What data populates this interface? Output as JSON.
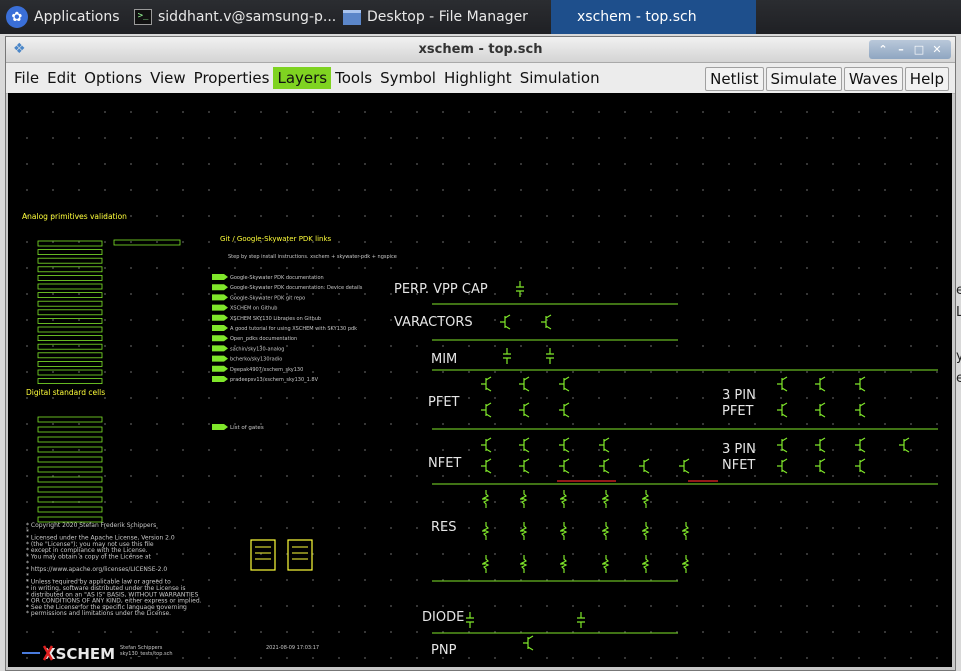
{
  "taskbar": {
    "applications": "Applications",
    "terminal": "siddhant.v@samsung-p...",
    "file_manager": "Desktop - File Manager",
    "xschem": "xschem - top.sch"
  },
  "window": {
    "title": "xschem - top.sch",
    "controls": [
      "⌃",
      "–",
      "□",
      "✕"
    ]
  },
  "menu": {
    "left": [
      "File",
      "Edit",
      "Options",
      "View",
      "Properties",
      "Layers",
      "Tools",
      "Symbol",
      "Highlight",
      "Simulation"
    ],
    "active": "Layers",
    "right": [
      "Netlist",
      "Simulate",
      "Waves",
      "Help"
    ]
  },
  "schematic": {
    "analog_title": "Analog primitives validation",
    "digital_title": "Digital standard cells",
    "links_title": "Git / Google-Skywater PDK links",
    "links_step": "Step by step install instructions. xschem + skywater-pdk + ngspice",
    "links": [
      "Google-Skywater PDK documentation",
      "Google-Skywater PDK documentation: Device details",
      "Google-Skywater PDK git repo",
      "XSCHEM on Github",
      "XSCHEM SKY130 Libraries on Github",
      "A good tutorial for using XSCHEM with SKY130 pdk",
      "Open_pdks documentation",
      "sachin/sky130-analog",
      "bcherko/sky130radio",
      "Deepak4907/xschem_sky130",
      "pradeepsv13/xschem_sky130_1.8V"
    ],
    "gates_link": "List of gates",
    "device_labels": [
      "PERP. VPP CAP",
      "VARACTORS",
      "MIM",
      "PFET",
      "NFET",
      "RES",
      "DIODE",
      "PNP"
    ],
    "three_pin_pfet": [
      "3 PIN",
      "PFET"
    ],
    "three_pin_nfet": [
      "3 PIN",
      "NFET"
    ],
    "license": [
      "* Copyright 2020 Stefan Frederik Schippers",
      "*",
      "* Licensed under the Apache License, Version 2.0",
      "* (the \"License\"); you may not use this file",
      "* except in compliance with the License.",
      "* You may obtain a copy of the License at",
      "*",
      "*      https://www.apache.org/licenses/LICENSE-2.0",
      "*",
      "* Unless required by applicable law or agreed to",
      "* in writing, software distributed under the License is",
      "* distributed on an \"AS IS\" BASIS, WITHOUT WARRANTIES",
      "* OR CONDITIONS OF ANY KIND, either express or implied.",
      "* See the License for the specific language governing",
      "* permissions and limitations under the License."
    ],
    "logo": "XSCHEM",
    "author": "Stefan Schippers",
    "file": "sky130_tests/top.sch",
    "date": "2021-08-09   17:03:17"
  },
  "colors": {
    "wire": "#7fe62a",
    "label_yellow": "#ffff3a",
    "menu_highlight": "#7fd321",
    "logo_red": "#e02020"
  }
}
